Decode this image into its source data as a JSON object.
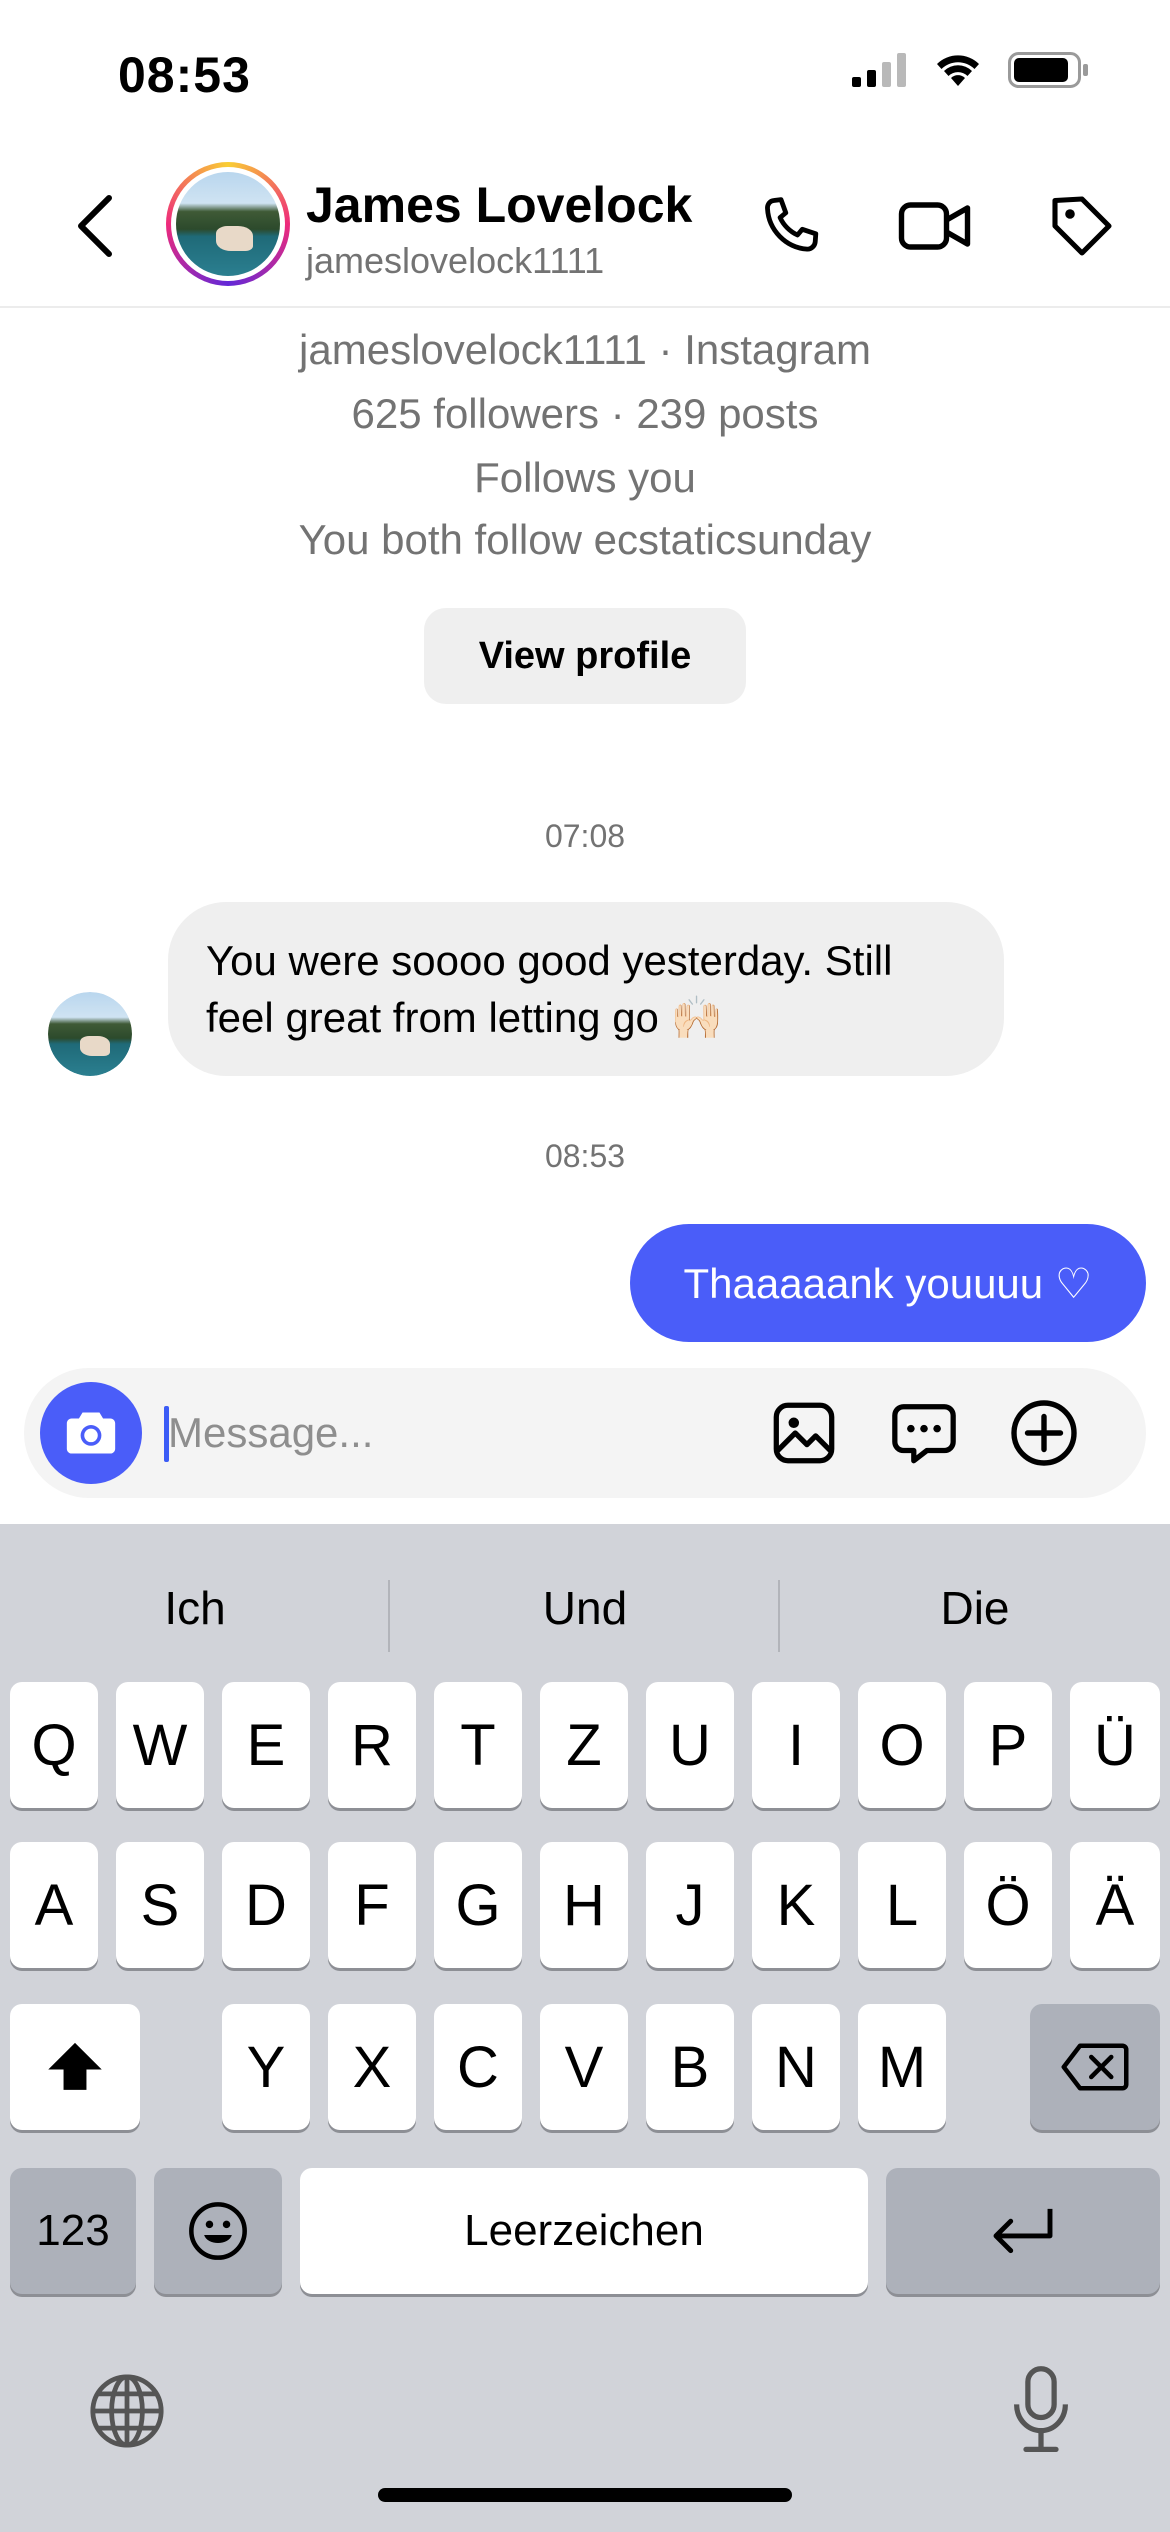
{
  "status_bar": {
    "time": "08:53"
  },
  "header": {
    "name": "James Lovelock",
    "username": "jameslovelock1111"
  },
  "profile_info": {
    "line1": "jameslovelock1111 · Instagram",
    "line2": "625 followers · 239 posts",
    "line3": "Follows you",
    "line4": "You both follow ecstaticsunday",
    "view_profile_label": "View profile"
  },
  "messages": [
    {
      "timestamp": "07:08",
      "direction": "incoming",
      "text_line1": "You were soooo good yesterday. Still",
      "text_line2": "feel great from letting go 🙌🏻"
    },
    {
      "timestamp": "08:53",
      "direction": "outgoing",
      "text": "Thaaaaank youuuu ♡"
    }
  ],
  "composer": {
    "placeholder": "Message..."
  },
  "keyboard": {
    "suggestions": [
      "Ich",
      "Und",
      "Die"
    ],
    "row1": [
      "Q",
      "W",
      "E",
      "R",
      "T",
      "Z",
      "U",
      "I",
      "O",
      "P",
      "Ü"
    ],
    "row2": [
      "A",
      "S",
      "D",
      "F",
      "G",
      "H",
      "J",
      "K",
      "L",
      "Ö",
      "Ä"
    ],
    "row3": [
      "Y",
      "X",
      "C",
      "V",
      "B",
      "N",
      "M"
    ],
    "numbers_label": "123",
    "space_label": "Leerzeichen"
  },
  "colors": {
    "accent": "#4a5df9",
    "keyboard_bg": "#d1d3d9",
    "bubble_in": "#efefef"
  },
  "icons": {
    "header": [
      "back-icon",
      "phone-icon",
      "video-icon",
      "tag-icon"
    ],
    "composer": [
      "camera-icon",
      "gallery-icon",
      "sticker-chat-icon",
      "plus-icon"
    ],
    "keyboard": [
      "shift-icon",
      "backspace-icon",
      "emoji-icon",
      "return-icon",
      "globe-icon",
      "microphone-icon"
    ]
  }
}
